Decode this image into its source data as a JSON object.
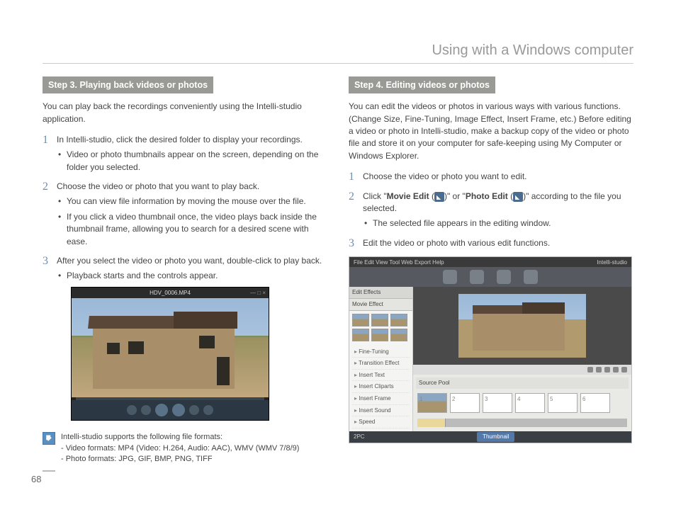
{
  "header": {
    "title": "Using with a Windows computer"
  },
  "page": {
    "number": "68"
  },
  "left": {
    "step_label": "Step 3. Playing back videos or photos",
    "intro": "You can play back the recordings conveniently using the Intelli-studio application.",
    "items": [
      {
        "n": "1",
        "text": "In Intelli-studio, click the desired folder to display your recordings.",
        "bullets": [
          "Video or photo thumbnails appear on the screen, depending on the folder you selected."
        ]
      },
      {
        "n": "2",
        "text": "Choose the video or photo that you want to play back.",
        "bullets": [
          "You can view file information by moving the mouse over the file.",
          "If you click a video thumbnail once, the video plays back inside the thumbnail frame, allowing you to search for a desired scene with ease."
        ]
      },
      {
        "n": "3",
        "text": "After you select the video or photo you want, double-click to play back.",
        "bullets": [
          "Playback starts and the controls appear."
        ]
      }
    ],
    "player": {
      "filename": "HDV_0006.MP4"
    },
    "note": {
      "lines": [
        "Intelli-studio supports the following file formats:",
        "- Video formats: MP4 (Video: H.264, Audio: AAC), WMV (WMV 7/8/9)",
        "- Photo formats: JPG, GIF, BMP, PNG, TIFF"
      ]
    }
  },
  "right": {
    "step_label": "Step 4. Editing videos or photos",
    "intro": "You can edit the videos or photos in various ways with various functions. (Change Size, Fine-Tuning, Image Effect, Insert Frame, etc.) Before editing a video or photo in Intelli-studio, make a backup copy of the video or photo file and store it on your computer for safe-keeping using My Computer or Windows Explorer.",
    "items": [
      {
        "n": "1",
        "text": "Choose the video or photo you want to edit.",
        "bullets": []
      },
      {
        "n": "2",
        "pre": "Click \"",
        "b1": "Movie Edit",
        "mid1": " (",
        "mid2": ")\" or \"",
        "b2": "Photo Edit",
        "mid3": " (",
        "post": ")\" according to the file you selected.",
        "bullets": [
          "The selected file appears in the editing window."
        ]
      },
      {
        "n": "3",
        "text": "Edit the video or photo with various edit functions.",
        "bullets": []
      }
    ],
    "editor": {
      "side_header1": "Edit Effects",
      "side_header2": "Movie Effect",
      "side_list": [
        "Fine-Tuning",
        "Transition Effect",
        "Insert Text",
        "Insert Cliparts",
        "Insert Frame",
        "Insert Sound",
        "Speed"
      ],
      "panel_header": "Source Pool",
      "bottom_left": "2PC",
      "bottom_mid": "Thumbnail",
      "menu": "File  Edit  View  Tool  Web Export  Help",
      "brand": "Intelli-studio"
    }
  }
}
